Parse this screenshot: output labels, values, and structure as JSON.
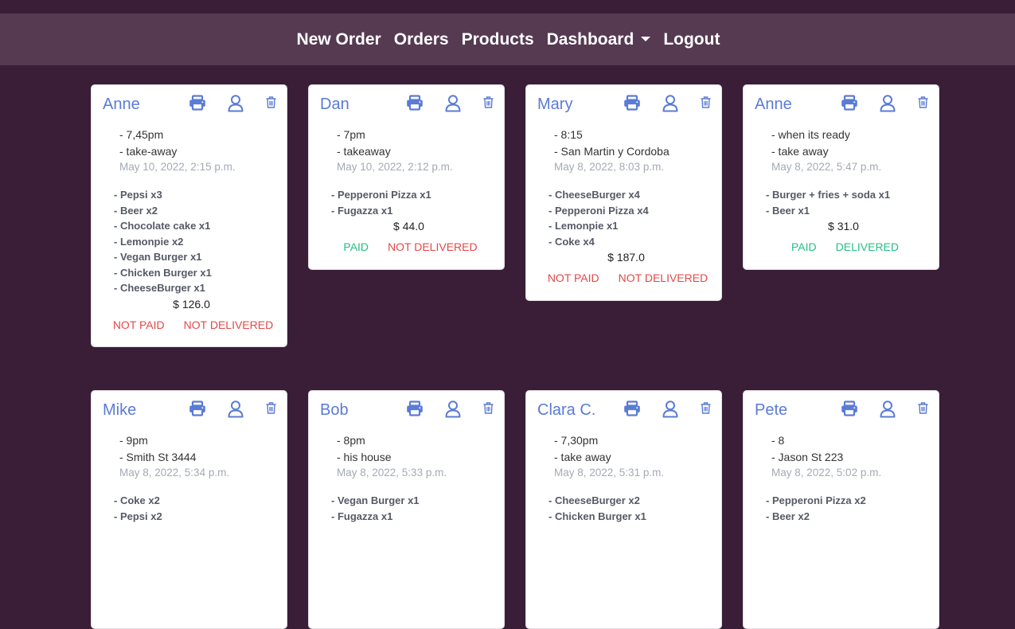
{
  "nav": {
    "items": [
      "New Order",
      "Orders",
      "Products",
      "Dashboard",
      "Logout"
    ]
  },
  "colors": {
    "background": "#3a1d36",
    "navbar": "#553a52",
    "accent": "#5a7bd6",
    "paid": "#26be86",
    "not_paid": "#e44848"
  },
  "icons": {
    "print": "printer-icon",
    "customer": "user-icon",
    "delete": "trash-icon"
  },
  "orders": [
    {
      "name": "Anne",
      "notes": [
        "- 7,45pm",
        "- take-away"
      ],
      "date": "May 10, 2022, 2:15 p.m.",
      "items": [
        "- Pepsi x3",
        "- Beer x2",
        "- Chocolate cake x1",
        "- Lemonpie x2",
        "- Vegan Burger x1",
        "- Chicken Burger x1",
        "- CheeseBurger x1"
      ],
      "total": "$ 126.0",
      "payment": "NOT PAID",
      "delivery": "NOT DELIVERED"
    },
    {
      "name": "Dan",
      "notes": [
        "- 7pm",
        "- takeaway"
      ],
      "date": "May 10, 2022, 2:12 p.m.",
      "items": [
        "- Pepperoni Pizza x1",
        "- Fugazza x1"
      ],
      "total": "$ 44.0",
      "payment": "PAID",
      "delivery": "NOT DELIVERED"
    },
    {
      "name": "Mary",
      "notes": [
        "- 8:15",
        "- San Martin y Cordoba"
      ],
      "date": "May 8, 2022, 8:03 p.m.",
      "items": [
        "- CheeseBurger x4",
        "- Pepperoni Pizza x4",
        "- Lemonpie x1",
        "- Coke x4"
      ],
      "total": "$ 187.0",
      "payment": "NOT PAID",
      "delivery": "NOT DELIVERED"
    },
    {
      "name": "Anne",
      "notes": [
        "- when its ready",
        "- take away"
      ],
      "date": "May 8, 2022, 5:47 p.m.",
      "items": [
        "- Burger + fries + soda x1",
        "- Beer x1"
      ],
      "total": "$ 31.0",
      "payment": "PAID",
      "delivery": "DELIVERED"
    },
    {
      "name": "Mike",
      "notes": [
        "- 9pm",
        "- Smith St 3444"
      ],
      "date": "May 8, 2022, 5:34 p.m.",
      "items": [
        "- Coke x2",
        "- Pepsi x2"
      ]
    },
    {
      "name": "Bob",
      "notes": [
        "- 8pm",
        "- his house"
      ],
      "date": "May 8, 2022, 5:33 p.m.",
      "items": [
        "- Vegan Burger x1",
        "- Fugazza x1"
      ]
    },
    {
      "name": "Clara C.",
      "notes": [
        "- 7,30pm",
        "- take away"
      ],
      "date": "May 8, 2022, 5:31 p.m.",
      "items": [
        "- CheeseBurger x2",
        "- Chicken Burger x1"
      ]
    },
    {
      "name": "Pete",
      "notes": [
        "- 8",
        "- Jason St 223"
      ],
      "date": "May 8, 2022, 5:02 p.m.",
      "items": [
        "- Pepperoni Pizza x2",
        "- Beer x2"
      ]
    }
  ]
}
